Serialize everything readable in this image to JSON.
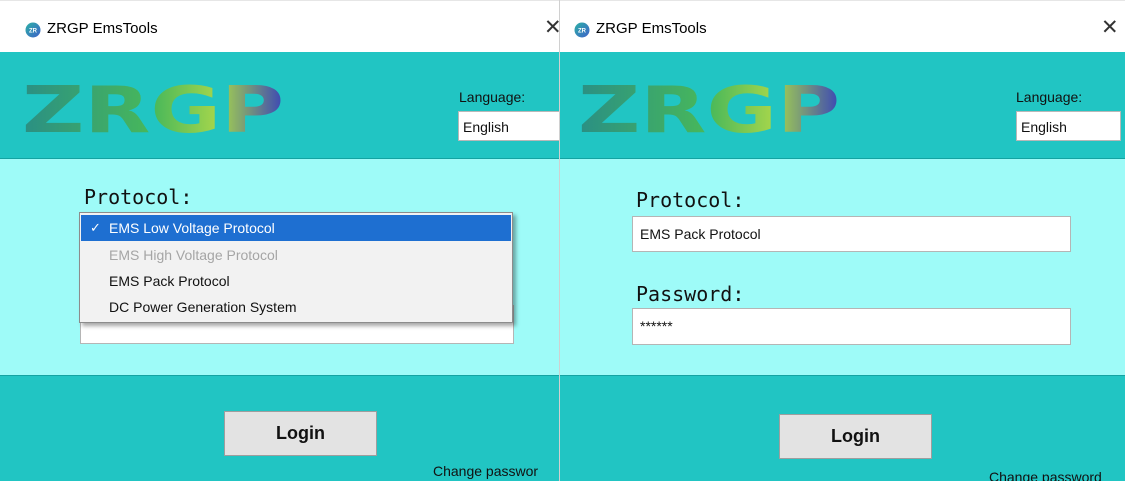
{
  "colors": {
    "teal": "#21c5c3",
    "light_cyan": "#9efbf8",
    "selection": "#1e6fd1"
  },
  "left": {
    "title": "ZRGP EmsTools",
    "close": "✕",
    "logo": "ZRGP",
    "language_label": "Language:",
    "language_value": "English",
    "protocol_label": "Protocol:",
    "dropdown": [
      {
        "label": "EMS Low Voltage Protocol",
        "check": "✓",
        "state": "selected"
      },
      {
        "label": "EMS High Voltage Protocol",
        "state": "disabled"
      },
      {
        "label": "EMS Pack Protocol",
        "state": "normal"
      },
      {
        "label": "DC Power Generation System",
        "state": "normal"
      }
    ],
    "login": "Login",
    "change_password": "Change passwor"
  },
  "right": {
    "title": "ZRGP EmsTools",
    "close": "✕",
    "logo": "ZRGP",
    "language_label": "Language:",
    "language_value": "English",
    "protocol_label": "Protocol:",
    "protocol_value": "EMS Pack Protocol",
    "password_label": "Password:",
    "password_value": "******",
    "login": "Login",
    "change_password": "Change password"
  }
}
